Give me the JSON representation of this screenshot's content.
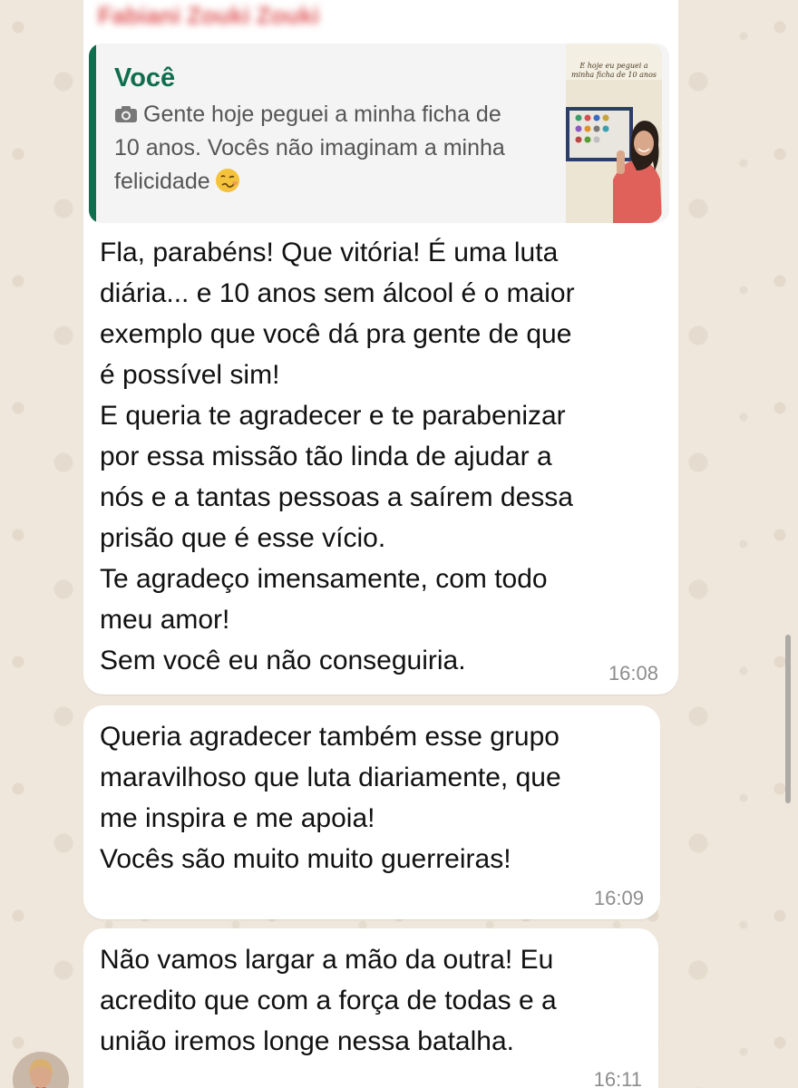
{
  "chat": {
    "sender_name": "Fabiani Zouki Zouki",
    "messages": [
      {
        "quoted": {
          "author": "Você",
          "text": "Gente hoje peguei a minha ficha de\n10 anos. Vocês não imaginam a minha\nfelicidade",
          "media_icon": "camera-icon",
          "emoji": "woozy-face-emoji",
          "thumbnail_caption": "E hoje eu peguei a minha ficha de 10 anos"
        },
        "text": "Fla, parabéns! Que vitória! É uma luta\ndiária... e 10 anos sem álcool é o maior\nexemplo que você dá pra gente de que\né possível sim!\nE queria te agradecer e te parabenizar\npor essa missão tão linda de ajudar a\nnós e a tantas pessoas a saírem dessa\nprisão que é esse vício.\nTe agradeço imensamente, com todo\nmeu amor!\nSem você eu não conseguiria.",
        "time": "16:08"
      },
      {
        "text": "Queria agradecer também esse grupo\nmaravilhoso que luta diariamente, que\nme inspira e me apoia!\nVocês são muito muito guerreiras!",
        "time": "16:09"
      },
      {
        "text": "Não vamos largar a mão da outra! Eu\nacredito que com a força de todas e a\nunião iremos longe nessa batalha.",
        "time": "16:11"
      }
    ]
  },
  "colors": {
    "background": "#efe7dc",
    "bubble": "#ffffff",
    "quote_accent": "#0e6e4d",
    "sender_name": "#e05a5a",
    "time": "#8d8d8d"
  }
}
